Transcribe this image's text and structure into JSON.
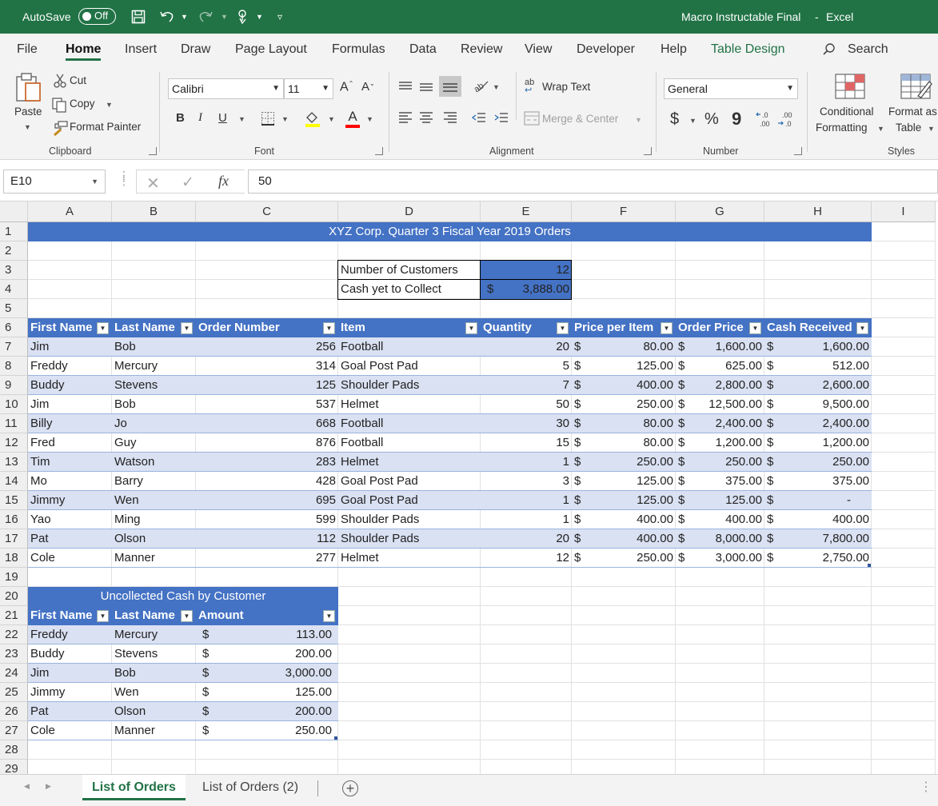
{
  "titlebar": {
    "autosave_label": "AutoSave",
    "autosave_state": "Off",
    "doc_title": "Macro Instructable Final",
    "separator": "-",
    "app_name": "Excel"
  },
  "tabs": [
    "File",
    "Home",
    "Insert",
    "Draw",
    "Page Layout",
    "Formulas",
    "Data",
    "Review",
    "View",
    "Developer",
    "Help",
    "Table Design"
  ],
  "search_label": "Search",
  "ribbon": {
    "clipboard": {
      "paste": "Paste",
      "cut": "Cut",
      "copy": "Copy",
      "format_painter": "Format Painter",
      "group": "Clipboard"
    },
    "font": {
      "name": "Calibri",
      "size": "11",
      "bold": "B",
      "italic": "I",
      "underline": "U",
      "group": "Font"
    },
    "alignment": {
      "wrap_text": "Wrap Text",
      "merge_center": "Merge & Center",
      "group": "Alignment"
    },
    "number": {
      "format": "General",
      "currency": "$",
      "percent": "%",
      "comma": "9",
      "group": "Number"
    },
    "styles": {
      "conditional": "Conditional",
      "formatting": "Formatting",
      "format_as": "Format as",
      "table": "Table",
      "group": "Styles"
    }
  },
  "formula_bar": {
    "cell_ref": "E10",
    "fx": "fx",
    "value": "50"
  },
  "columns": [
    "A",
    "B",
    "C",
    "D",
    "E",
    "F",
    "G",
    "H",
    "I"
  ],
  "rows": [
    "1",
    "2",
    "3",
    "4",
    "5",
    "6",
    "7",
    "8",
    "9",
    "10",
    "11",
    "12",
    "13",
    "14",
    "15",
    "16",
    "17",
    "18",
    "19",
    "20",
    "21",
    "22",
    "23",
    "24",
    "25",
    "26",
    "27",
    "28",
    "29"
  ],
  "sheet_title": "XYZ Corp. Quarter 3 Fiscal Year 2019 Orders",
  "summary": {
    "customers_label": "Number of Customers",
    "customers_value": "12",
    "cash_label": "Cash yet to Collect",
    "cash_sym": "$",
    "cash_value": "3,888.00"
  },
  "orders_headers": [
    "First Name",
    "Last Name",
    "Order Number",
    "Item",
    "Quantity",
    "Price per Item",
    "Order Price",
    "Cash Received"
  ],
  "orders": [
    [
      "Jim",
      "Bob",
      "256",
      "Football",
      "20",
      "80.00",
      "1,600.00",
      "1,600.00"
    ],
    [
      "Freddy",
      "Mercury",
      "314",
      "Goal Post Pad",
      "5",
      "125.00",
      "625.00",
      "512.00"
    ],
    [
      "Buddy",
      "Stevens",
      "125",
      "Shoulder Pads",
      "7",
      "400.00",
      "2,800.00",
      "2,600.00"
    ],
    [
      "Jim",
      "Bob",
      "537",
      "Helmet",
      "50",
      "250.00",
      "12,500.00",
      "9,500.00"
    ],
    [
      "Billy",
      "Jo",
      "668",
      "Football",
      "30",
      "80.00",
      "2,400.00",
      "2,400.00"
    ],
    [
      "Fred",
      "Guy",
      "876",
      "Football",
      "15",
      "80.00",
      "1,200.00",
      "1,200.00"
    ],
    [
      "Tim",
      "Watson",
      "283",
      "Helmet",
      "1",
      "250.00",
      "250.00",
      "250.00"
    ],
    [
      "Mo",
      "Barry",
      "428",
      "Goal Post Pad",
      "3",
      "125.00",
      "375.00",
      "375.00"
    ],
    [
      "Jimmy",
      "Wen",
      "695",
      "Goal Post Pad",
      "1",
      "125.00",
      "125.00",
      "-"
    ],
    [
      "Yao",
      "Ming",
      "599",
      "Shoulder Pads",
      "1",
      "400.00",
      "400.00",
      "400.00"
    ],
    [
      "Pat",
      "Olson",
      "112",
      "Shoulder Pads",
      "20",
      "400.00",
      "8,000.00",
      "7,800.00"
    ],
    [
      "Cole",
      "Manner",
      "277",
      "Helmet",
      "12",
      "250.00",
      "3,000.00",
      "2,750.00"
    ]
  ],
  "currency_symbol": "$",
  "uncollected_title": "Uncollected Cash by Customer",
  "uncollected_headers": [
    "First Name",
    "Last Name",
    "Amount"
  ],
  "uncollected": [
    [
      "Freddy",
      "Mercury",
      "113.00"
    ],
    [
      "Buddy",
      "Stevens",
      "200.00"
    ],
    [
      "Jim",
      "Bob",
      "3,000.00"
    ],
    [
      "Jimmy",
      "Wen",
      "125.00"
    ],
    [
      "Pat",
      "Olson",
      "200.00"
    ],
    [
      "Cole",
      "Manner",
      "250.00"
    ]
  ],
  "sheets": [
    "List of Orders",
    "List of Orders (2)"
  ],
  "add_sheet": "+",
  "colors": {
    "excel_green": "#217346",
    "table_header": "#4472c4",
    "band": "#d9e1f2",
    "ribbon": "#f3f3f3"
  }
}
